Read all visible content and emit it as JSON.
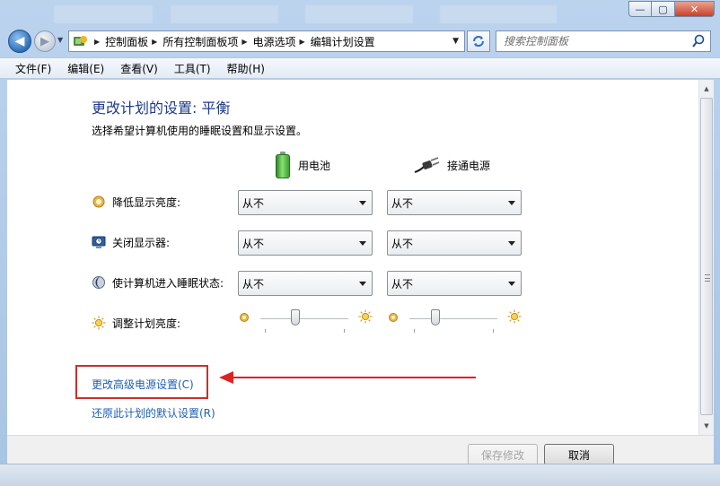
{
  "window": {
    "controls": {
      "minimize": "—",
      "maximize": "▢",
      "close": "✕"
    }
  },
  "address": {
    "breadcrumbs": [
      "控制面板",
      "所有控制面板项",
      "电源选项",
      "编辑计划设置"
    ],
    "search_placeholder": "搜索控制面板"
  },
  "menu": [
    "文件(F)",
    "编辑(E)",
    "查看(V)",
    "工具(T)",
    "帮助(H)"
  ],
  "plan": {
    "title": "更改计划的设置: 平衡",
    "subtitle": "选择希望计算机使用的睡眠设置和显示设置。",
    "columns": {
      "battery": "用电池",
      "plugged": "接通电源"
    },
    "rows": [
      {
        "label": "降低显示亮度:",
        "battery": "从不",
        "plugged": "从不",
        "icon": "dim-display-icon"
      },
      {
        "label": "关闭显示器:",
        "battery": "从不",
        "plugged": "从不",
        "icon": "monitor-off-icon"
      },
      {
        "label": "使计算机进入睡眠状态:",
        "battery": "从不",
        "plugged": "从不",
        "icon": "sleep-moon-icon"
      }
    ],
    "brightness": {
      "label": "调整计划亮度:",
      "battery_level": 0.4,
      "plugged_level": 0.3
    }
  },
  "links": {
    "advanced": "更改高级电源设置(C)",
    "restore": "还原此计划的默认设置(R)"
  },
  "buttons": {
    "save": "保存修改",
    "cancel": "取消"
  },
  "colors": {
    "title": "#1e3a8a",
    "link": "#1d5fb8",
    "annotation": "#d22222"
  }
}
